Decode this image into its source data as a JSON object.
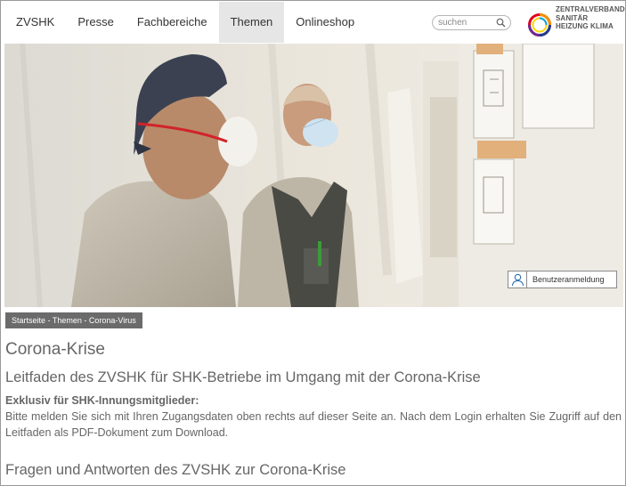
{
  "nav": {
    "items": [
      {
        "label": "ZVSHK"
      },
      {
        "label": "Presse"
      },
      {
        "label": "Fachbereiche"
      },
      {
        "label": "Themen"
      },
      {
        "label": "Onlineshop"
      }
    ]
  },
  "search": {
    "placeholder": "suchen",
    "icon": "search-icon"
  },
  "logo": {
    "lines": [
      "ZENTRALVERBAND",
      "SANITÄR",
      "HEIZUNG KLIMA"
    ],
    "colors": [
      "#e2001a",
      "#f39200",
      "#ffd500",
      "#009fe3",
      "#1d3f8f",
      "#6a2c91"
    ]
  },
  "hero": {
    "login_label": "Benutzeranmeldung",
    "login_icon": "user-icon"
  },
  "breadcrumb": {
    "items": [
      "Startseite",
      "Themen",
      "Corona-Virus"
    ],
    "separator": " - "
  },
  "content": {
    "title": "Corona-Krise",
    "subtitle": "Leitfaden des ZVSHK für SHK-Betriebe im Umgang mit der Corona-Krise",
    "exclusive": "Exklusiv für SHK-Innungsmitglieder:",
    "body": "Bitte melden Sie sich mit Ihren Zugangsdaten oben rechts auf dieser Seite an. Nach dem Login erhalten Sie Zugriff auf den Leitfaden als PDF-Dokument zum Download.",
    "faq_heading": "Fragen und Antworten des ZVSHK zur Corona-Krise"
  }
}
